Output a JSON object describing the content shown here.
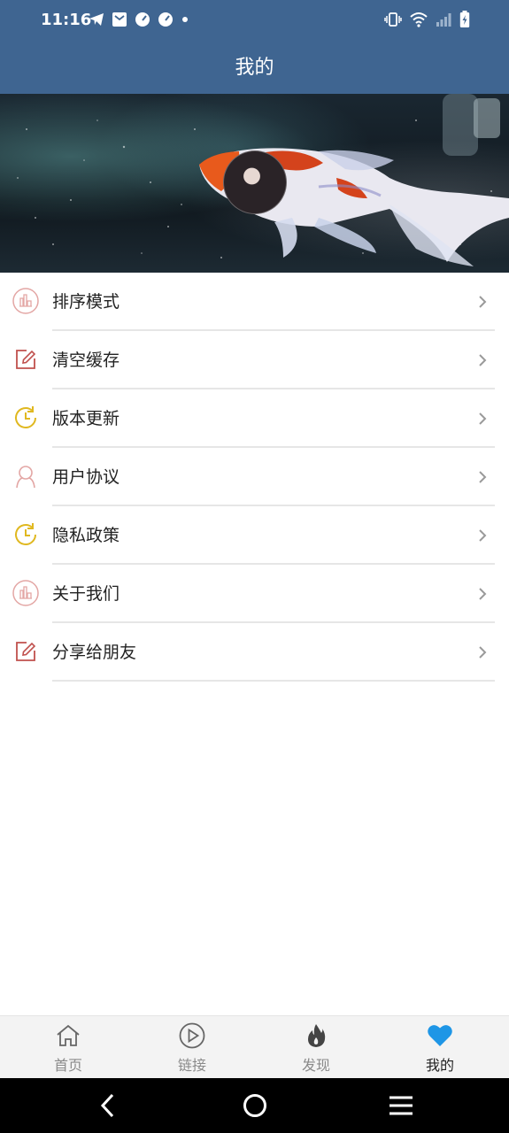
{
  "status": {
    "time": "11:16"
  },
  "header": {
    "title": "我的"
  },
  "menu": {
    "items": [
      {
        "label": "排序模式",
        "icon": "chart-icon"
      },
      {
        "label": "清空缓存",
        "icon": "edit-icon"
      },
      {
        "label": "版本更新",
        "icon": "clock-refresh-icon"
      },
      {
        "label": "用户协议",
        "icon": "user-icon"
      },
      {
        "label": "隐私政策",
        "icon": "clock-refresh-icon"
      },
      {
        "label": "关于我们",
        "icon": "chart-icon"
      },
      {
        "label": "分享给朋友",
        "icon": "edit-icon"
      }
    ]
  },
  "bottom_nav": {
    "items": [
      {
        "label": "首页",
        "icon": "home-icon",
        "active": false
      },
      {
        "label": "链接",
        "icon": "play-icon",
        "active": false
      },
      {
        "label": "发现",
        "icon": "fire-icon",
        "active": false
      },
      {
        "label": "我的",
        "icon": "heart-icon",
        "active": true
      }
    ]
  },
  "colors": {
    "header_bg": "#3f6591",
    "active_tab": "#1e96e6",
    "icon_red": "#c0504d",
    "icon_yellow": "#e0b820",
    "icon_pink": "#e3a6a4"
  }
}
